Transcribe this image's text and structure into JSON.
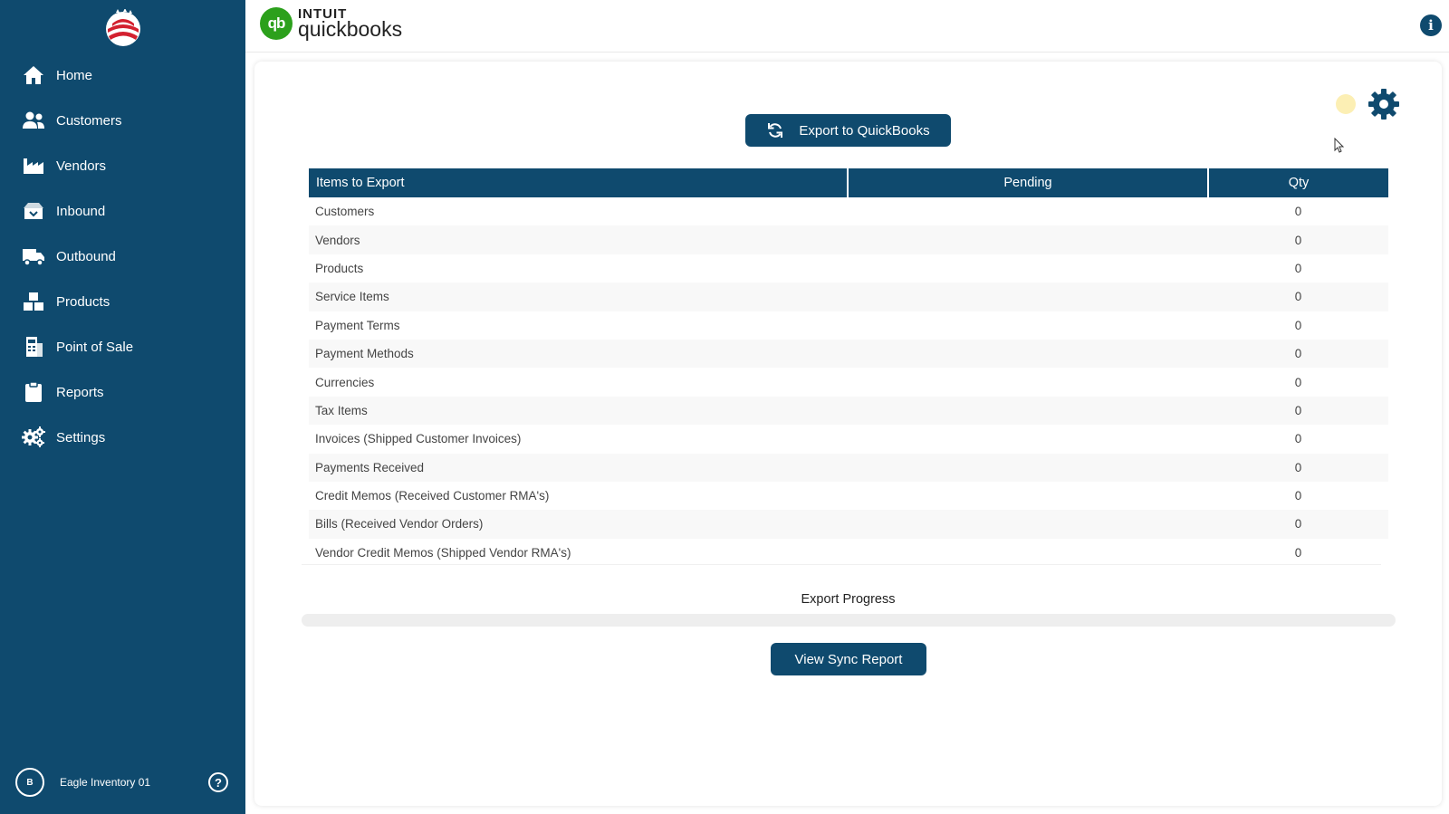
{
  "sidebar": {
    "items": [
      {
        "label": "Home",
        "icon": "home-icon"
      },
      {
        "label": "Customers",
        "icon": "users-icon"
      },
      {
        "label": "Vendors",
        "icon": "factory-icon"
      },
      {
        "label": "Inbound",
        "icon": "inbound-box-icon"
      },
      {
        "label": "Outbound",
        "icon": "truck-icon"
      },
      {
        "label": "Products",
        "icon": "boxes-icon"
      },
      {
        "label": "Point of Sale",
        "icon": "register-icon"
      },
      {
        "label": "Reports",
        "icon": "clipboard-icon"
      },
      {
        "label": "Settings",
        "icon": "gears-icon"
      }
    ],
    "user": {
      "initial": "B",
      "name": "Eagle Inventory 01"
    },
    "help_icon": "?"
  },
  "header": {
    "brand_top": "INTUIT",
    "brand_name": "quickbooks",
    "brand_badge": "qb",
    "info_icon": "i"
  },
  "main": {
    "export_button": "Export to QuickBooks",
    "table": {
      "headers": [
        "Items to Export",
        "Pending",
        "Qty"
      ],
      "rows": [
        {
          "name": "Customers",
          "pending": "",
          "qty": "0"
        },
        {
          "name": "Vendors",
          "pending": "",
          "qty": "0"
        },
        {
          "name": "Products",
          "pending": "",
          "qty": "0"
        },
        {
          "name": "Service Items",
          "pending": "",
          "qty": "0"
        },
        {
          "name": "Payment Terms",
          "pending": "",
          "qty": "0"
        },
        {
          "name": "Payment Methods",
          "pending": "",
          "qty": "0"
        },
        {
          "name": "Currencies",
          "pending": "",
          "qty": "0"
        },
        {
          "name": "Tax Items",
          "pending": "",
          "qty": "0"
        },
        {
          "name": "Invoices (Shipped Customer Invoices)",
          "pending": "",
          "qty": "0"
        },
        {
          "name": "Payments Received",
          "pending": "",
          "qty": "0"
        },
        {
          "name": "Credit Memos (Received Customer RMA's)",
          "pending": "",
          "qty": "0"
        },
        {
          "name": "Bills (Received Vendor Orders)",
          "pending": "",
          "qty": "0"
        },
        {
          "name": "Vendor Credit Memos (Shipped Vendor RMA's)",
          "pending": "",
          "qty": "0"
        }
      ]
    },
    "progress_label": "Export Progress",
    "progress_fraction": 0,
    "sync_report_button": "View Sync Report"
  },
  "colors": {
    "sidebar_bg": "#0f4a6e",
    "primary": "#0f4a6e",
    "qb_green": "#2ca01c",
    "status_dot": "#fcefb4"
  }
}
